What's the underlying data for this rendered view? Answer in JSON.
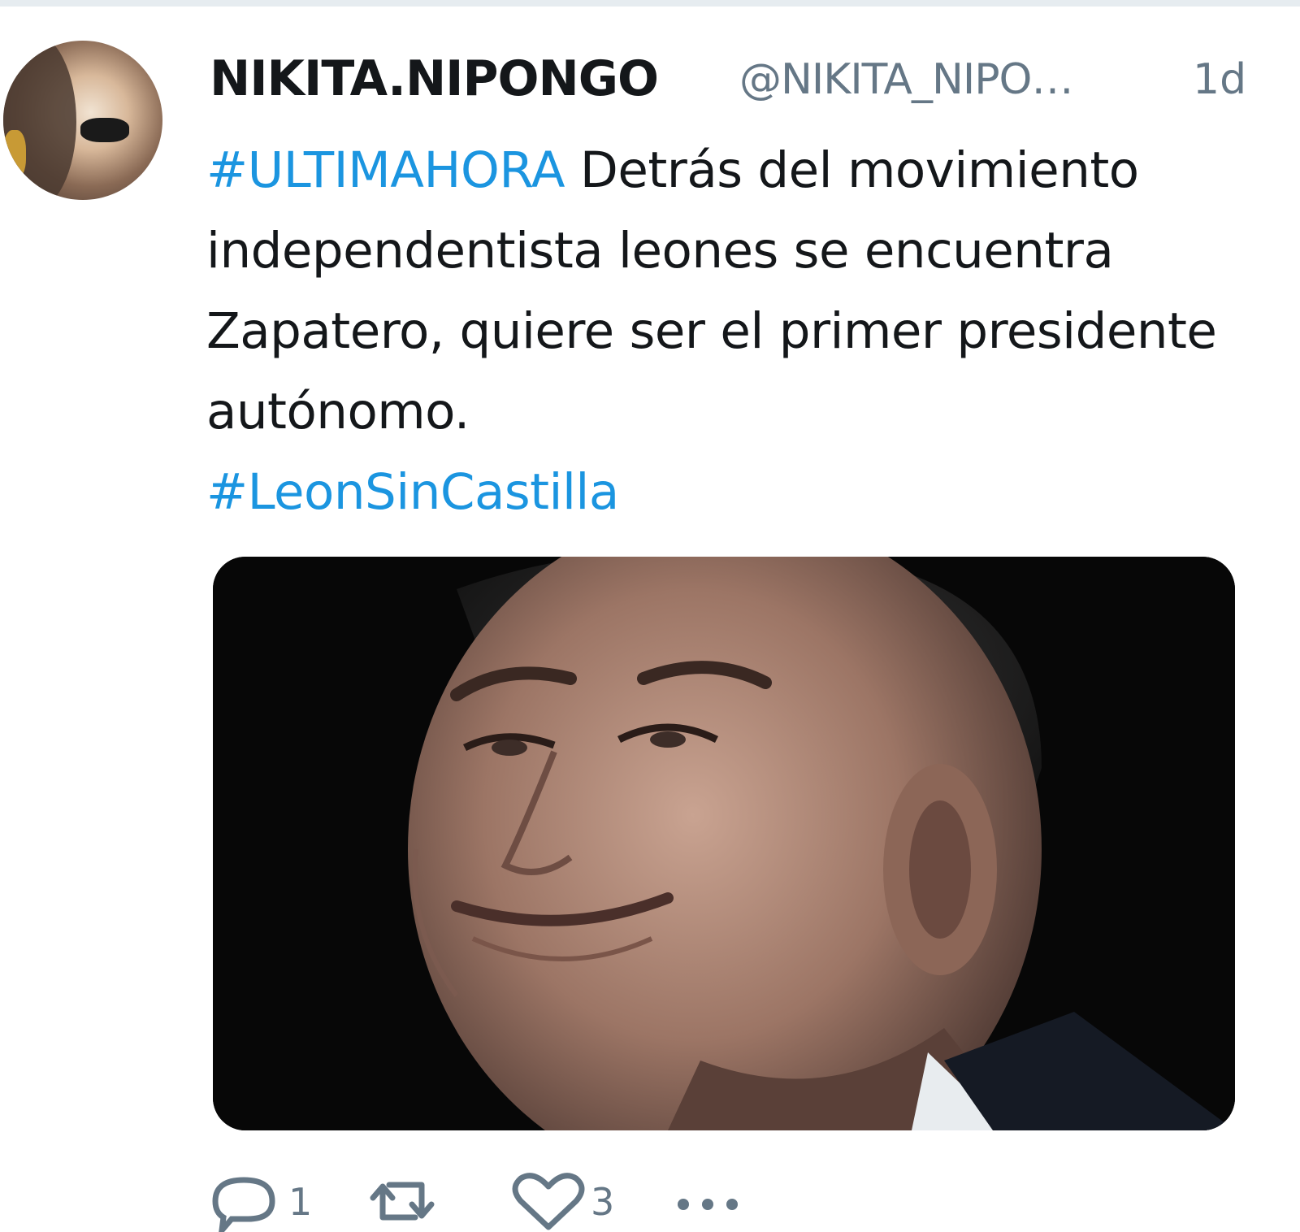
{
  "tweet": {
    "display_name": "NIKITA.NIPONGO",
    "handle": "@NIKITA_NIPO…",
    "timestamp": "1d",
    "text_parts": {
      "hashtag1": "#ULTIMAHORA",
      "body": " Detrás del movimiento independentista leones se encuentra Zapatero, quiere ser el primer presidente autónomo.",
      "hashtag2": "#LeonSinCastilla"
    },
    "actions": {
      "reply_count": "1",
      "retweet_count": "",
      "like_count": "3"
    }
  },
  "colors": {
    "hashtag": "#1b95e0",
    "text": "#14171a",
    "muted": "#657786"
  },
  "icons": {
    "reply": "reply-icon",
    "retweet": "retweet-icon",
    "like": "heart-icon",
    "more": "more-icon"
  }
}
